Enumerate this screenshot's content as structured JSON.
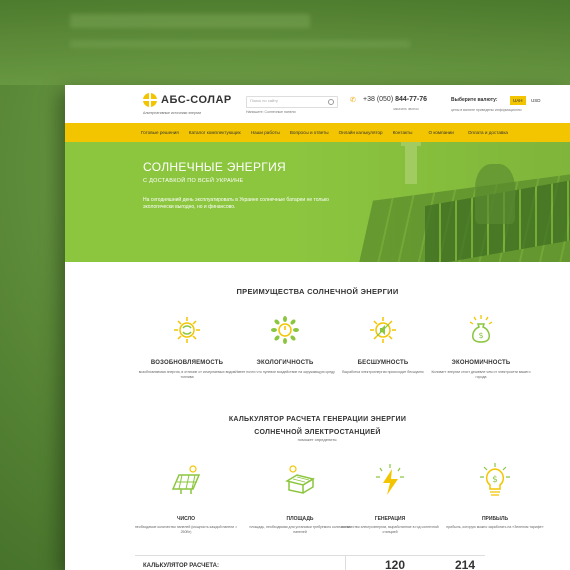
{
  "header": {
    "logo_text": "АБС-СОЛАР",
    "logo_sub": "Альтернативные источники энергии",
    "search_placeholder": "Поиск по сайту",
    "breadcrumbs": "Напишите: Солнечные панели",
    "phone_prefix": "+38 (050)",
    "phone_number": "844-77-76",
    "callback": "заказать звонок",
    "currency_label": "Выберите валюту:",
    "currency_active": "UAH",
    "currency_other": "USD",
    "currency_note": "цены в валюте приведены информационно"
  },
  "nav": [
    "Готовые решения",
    "Каталог комплектующих",
    "Наши работы",
    "Вопросы и ответы",
    "Онлайн калькулятор",
    "Контакты",
    "О компании",
    "Оплата и доставка"
  ],
  "hero": {
    "title": "СОЛНЕЧНЫЕ ЭНЕРГИЯ",
    "subtitle": "С ДОСТАВКОЙ ПО ВСЕЙ УКРАИНЕ",
    "text": "На сегодняшний день эксплуатировать в Украине солнечные батареи не только экологически выгодно, но и финансово."
  },
  "advantages": {
    "title": "ПРЕИМУЩЕСТВА СОЛНЕЧНОЙ ЭНЕРГИИ",
    "items": [
      {
        "label": "ВОЗОБНОВЛЯЕМОСТЬ",
        "desc": "возобновляемая энергия, в отличие от исчерпаемых видов топлива",
        "icon": "recycle-sun-icon"
      },
      {
        "label": "ЭКОЛОГИЧНОСТЬ",
        "desc": "Имеет почти что нулевое воздействие на окружающую среду",
        "icon": "eco-power-icon"
      },
      {
        "label": "БЕСШУМНОСТЬ",
        "desc": "Выработка электроэнергии происходит бесшумно",
        "icon": "silent-sun-icon"
      },
      {
        "label": "ЭКОНОМИЧНОСТЬ",
        "desc": "Киловатт энергии стоит дешевле чем от электросети вашего города",
        "icon": "money-bag-icon"
      }
    ]
  },
  "calculator": {
    "title_line1": "КАЛЬКУЛЯТОР РАСЧЕТА ГЕНЕРАЦИИ ЭНЕРГИИ",
    "title_line2": "СОЛНЕЧНОЙ ЭЛЕКТРОСТАНЦИЕЙ",
    "subtitle": "поможет определить:",
    "items": [
      {
        "label": "ЧИСЛО",
        "desc": "необходимое количество панелей (мощность каждой панели = 250Вт)",
        "icon": "solar-panel-icon"
      },
      {
        "label": "ПЛОЩАДЬ",
        "desc": "площадь, необходимая для установки требуемого количества панелей",
        "icon": "house-roof-icon"
      },
      {
        "label": "ГЕНЕРАЦИЯ",
        "desc": "количество электроэнергии, выработанное в год солнечной станцией",
        "icon": "lightning-icon"
      },
      {
        "label": "ПРИБЫЛЬ",
        "desc": "прибыль, которую можно заработать на «Зеленом тарифе»",
        "icon": "dollar-bulb-icon"
      }
    ],
    "box_label": "КАЛЬКУЛЯТОР РАСЧЕТА:",
    "value1": "120",
    "value2": "214"
  },
  "colors": {
    "accent": "#f2c500",
    "green": "#8cc63f"
  }
}
